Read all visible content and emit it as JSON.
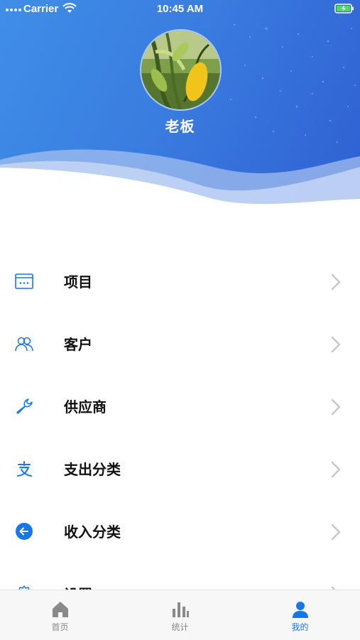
{
  "status_bar": {
    "carrier": "Carrier",
    "time": "10:45 AM",
    "wifi_icon": "wifi-icon",
    "battery_icon": "battery-charging-icon"
  },
  "profile": {
    "name": "老板",
    "avatar_icon": "avatar-photo"
  },
  "menu": {
    "items": [
      {
        "label": "项目",
        "icon": "project-window-icon"
      },
      {
        "label": "客户",
        "icon": "customers-icon"
      },
      {
        "label": "供应商",
        "icon": "wrench-icon"
      },
      {
        "label": "支出分类",
        "icon": "expense-category-icon"
      },
      {
        "label": "收入分类",
        "icon": "income-category-icon"
      },
      {
        "label": "设置",
        "icon": "gear-icon"
      }
    ]
  },
  "tabbar": {
    "tabs": [
      {
        "label": "首页",
        "icon": "home-icon",
        "active": false
      },
      {
        "label": "统计",
        "icon": "bar-chart-icon",
        "active": false
      },
      {
        "label": "我的",
        "icon": "person-icon",
        "active": true
      }
    ]
  },
  "colors": {
    "accent": "#1677e8",
    "header_blue": "#3a7de0",
    "inactive": "#8a8a8a",
    "chevron": "#c7c7cc"
  }
}
